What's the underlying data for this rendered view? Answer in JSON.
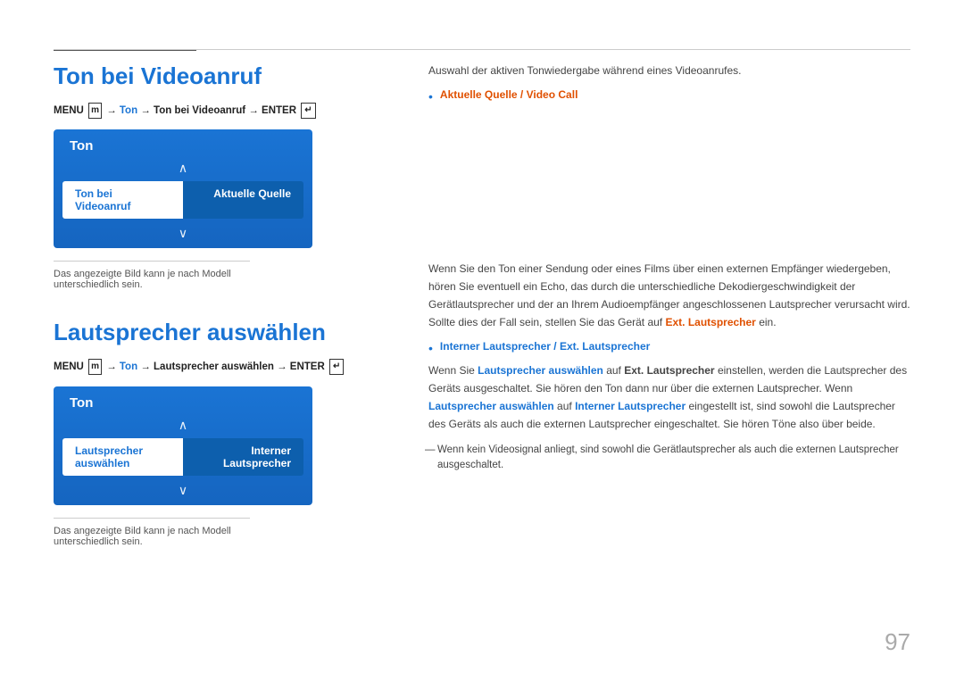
{
  "topLine": {},
  "section1": {
    "title": "Ton bei Videoanruf",
    "breadcrumb": {
      "prefix": "MENU",
      "menuIcon": "m",
      "arrow1": "→",
      "ton": "Ton",
      "arrow2": "→",
      "highlight": "Ton bei Videoanruf",
      "arrow3": "→",
      "enter": "ENTER",
      "enterIcon": "E"
    },
    "tvMenu": {
      "header": "Ton",
      "arrowUp": "∧",
      "itemLabel": "Ton bei Videoanruf",
      "itemValue": "Aktuelle Quelle",
      "arrowDown": "∨"
    },
    "noteText": "Das angezeigte Bild kann je nach Modell unterschiedlich sein.",
    "rightIntro": "Auswahl der aktiven Tonwiedergabe während eines Videoanrufes.",
    "bulletLabel": "Aktuelle Quelle / Video Call"
  },
  "section2": {
    "title": "Lautsprecher auswählen",
    "breadcrumb": {
      "prefix": "MENU",
      "menuIcon": "m",
      "arrow1": "→",
      "ton": "Ton",
      "arrow2": "→",
      "highlight": "Lautsprecher auswählen",
      "arrow3": "→",
      "enter": "ENTER",
      "enterIcon": "E"
    },
    "tvMenu": {
      "header": "Ton",
      "arrowUp": "∧",
      "itemLabel": "Lautsprecher auswählen",
      "itemValue": "Interner Lautsprecher",
      "arrowDown": "∨"
    },
    "noteText": "Das angezeigte Bild kann je nach Modell unterschiedlich sein.",
    "rightIntro": "Wenn Sie den Ton einer Sendung oder eines Films über einen externen Empfänger wiedergeben, hören Sie eventuell ein Echo, das durch die unterschiedliche Dekodiergeschwindigkeit der GeräteLautsprecher und der an Ihrem Audioempfänger angeschlossenen Lautsprecher verursacht wird. Sollte dies der Fall sein, stellen Sie das Gerät auf Ext. Lautsprecher ein.",
    "bulletLabel": "Interner Lautsprecher / Ext. Lautsprecher",
    "desc1": "Wenn Sie Lautsprecher auswählen auf Ext. Lautsprecher einstellen, werden die Lautsprecher des Geräts ausgeschaltet. Sie hören den Ton dann nur über die externen Lautsprecher. Wenn Lautsprecher auswählen auf Interner Lautsprecher eingestellt ist, sind sowohl die Lautsprecher des Geräts als auch die externen Lautsprecher eingeschaltet. Sie hören Töne also über beide.",
    "dashNote": "Wenn kein Videosignal anliegt, sind sowohl die Gerätlautsprecher als auch die externen Lautsprecher ausgeschaltet."
  },
  "pageNumber": "97"
}
